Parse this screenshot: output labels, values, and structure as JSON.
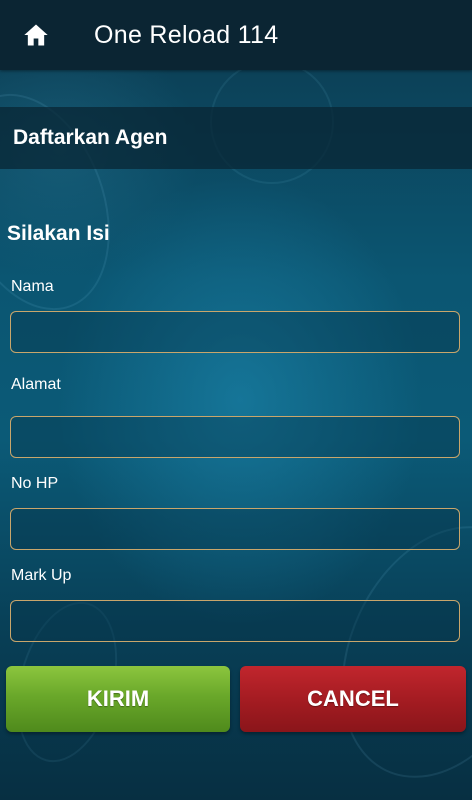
{
  "app": {
    "title": "One Reload 114",
    "home_icon": "home-icon"
  },
  "section": {
    "title": "Daftarkan Agen"
  },
  "form": {
    "heading": "Silakan Isi",
    "fields": [
      {
        "label": "Nama",
        "value": "",
        "placeholder": ""
      },
      {
        "label": "Alamat",
        "value": "",
        "placeholder": ""
      },
      {
        "label": "No HP",
        "value": "",
        "placeholder": ""
      },
      {
        "label": "Mark Up",
        "value": "",
        "placeholder": ""
      }
    ],
    "input_border_color": "#c9a66b"
  },
  "actions": {
    "submit_label": "KIRIM",
    "cancel_label": "CANCEL",
    "submit_color": "#6aa82a",
    "cancel_color": "#a51c22"
  }
}
